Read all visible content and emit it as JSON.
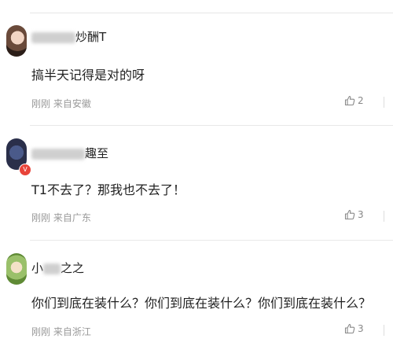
{
  "comments": [
    {
      "username_suffix": "炒酬T",
      "text": "搞半天记得是对的呀",
      "time": "刚刚",
      "source": "来自安徽",
      "likes": "2",
      "avatar_icon": "user-avatar"
    },
    {
      "username_suffix": "趣至",
      "text": "T1不去了？那我也不去了！",
      "time": "刚刚",
      "source": "来自广东",
      "likes": "3",
      "avatar_icon": "user-avatar",
      "badge": "V"
    },
    {
      "username_prefix": "小",
      "username_suffix": "之之",
      "text": "你们到底在装什么？你们到底在装什么？你们到底在装什么？",
      "time": "刚刚",
      "source": "来自浙江",
      "likes": "3",
      "avatar_icon": "user-avatar"
    }
  ],
  "colors": {
    "text": "#222222",
    "meta": "#999999",
    "badge": "#e8443a"
  }
}
